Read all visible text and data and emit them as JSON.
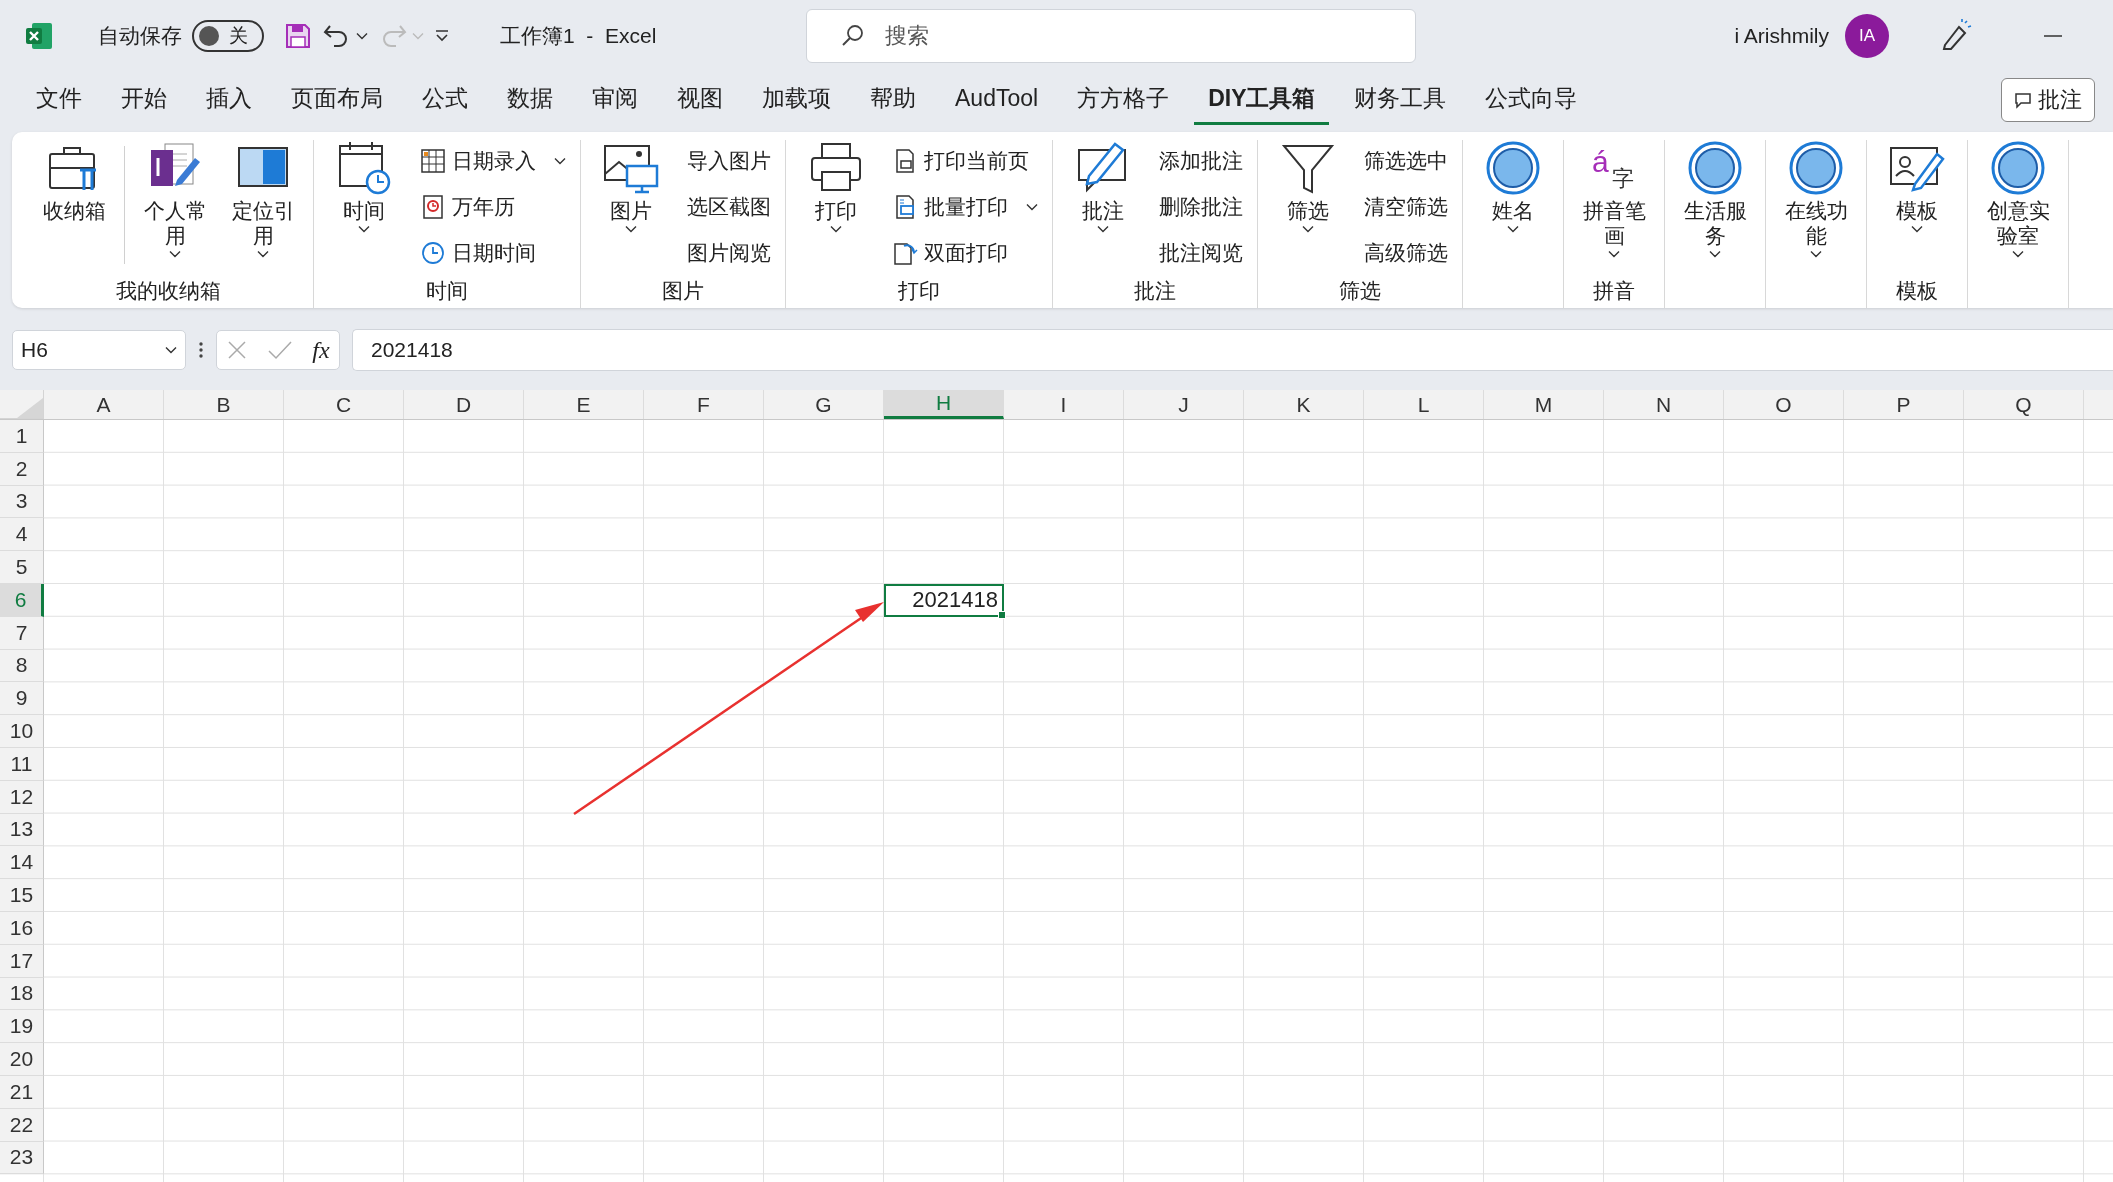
{
  "title_bar": {
    "autosave_label": "自动保存",
    "autosave": {
      "label": "关",
      "on": false
    },
    "redo": {
      "disabled": true
    },
    "title": "工作簿1  -  Excel",
    "search": {
      "placeholder": "搜索"
    },
    "user_name": "i Arishmily",
    "avatar_initials": "IA"
  },
  "tabs": [
    {
      "label": "文件",
      "selected": false
    },
    {
      "label": "开始",
      "selected": false
    },
    {
      "label": "插入",
      "selected": false
    },
    {
      "label": "页面布局",
      "selected": false
    },
    {
      "label": "公式",
      "selected": false
    },
    {
      "label": "数据",
      "selected": false
    },
    {
      "label": "审阅",
      "selected": false
    },
    {
      "label": "视图",
      "selected": false
    },
    {
      "label": "加载项",
      "selected": false
    },
    {
      "label": "帮助",
      "selected": false
    },
    {
      "label": "AudTool",
      "selected": false
    },
    {
      "label": "方方格子",
      "selected": false
    },
    {
      "label": "DIY工具箱",
      "selected": true
    },
    {
      "label": "财务工具",
      "selected": false
    },
    {
      "label": "公式向导",
      "selected": false
    }
  ],
  "comments_button": "批注",
  "ribbon": [
    {
      "label": "我的收纳箱",
      "items": [
        {
          "kind": "large",
          "label": "收纳箱",
          "dropdown": false
        },
        {
          "kind": "large",
          "label": "个人常用",
          "dropdown": true
        },
        {
          "kind": "large",
          "label": "定位引用",
          "dropdown": true
        }
      ]
    },
    {
      "label": "时间",
      "items": [
        {
          "kind": "large",
          "label": "时间",
          "dropdown": true
        },
        {
          "kind": "small",
          "label": "日期录入",
          "dropdown": true
        },
        {
          "kind": "small",
          "label": "万年历",
          "dropdown": false
        },
        {
          "kind": "small",
          "label": "日期时间",
          "dropdown": false
        }
      ]
    },
    {
      "label": "图片",
      "items": [
        {
          "kind": "large",
          "label": "图片",
          "dropdown": true
        },
        {
          "kind": "small",
          "label": "导入图片",
          "dropdown": false
        },
        {
          "kind": "small",
          "label": "选区截图",
          "dropdown": false
        },
        {
          "kind": "small",
          "label": "图片阅览",
          "dropdown": false
        }
      ]
    },
    {
      "label": "打印",
      "items": [
        {
          "kind": "large",
          "label": "打印",
          "dropdown": true
        },
        {
          "kind": "small",
          "label": "打印当前页",
          "dropdown": false
        },
        {
          "kind": "small",
          "label": "批量打印",
          "dropdown": true
        },
        {
          "kind": "small",
          "label": "双面打印",
          "dropdown": false
        }
      ]
    },
    {
      "label": "批注",
      "items": [
        {
          "kind": "large",
          "label": "批注",
          "dropdown": true
        },
        {
          "kind": "small",
          "label": "添加批注",
          "dropdown": false
        },
        {
          "kind": "small",
          "label": "删除批注",
          "dropdown": false
        },
        {
          "kind": "small",
          "label": "批注阅览",
          "dropdown": false
        }
      ]
    },
    {
      "label": "筛选",
      "items": [
        {
          "kind": "large",
          "label": "筛选",
          "dropdown": true
        },
        {
          "kind": "small",
          "label": "筛选选中",
          "dropdown": false
        },
        {
          "kind": "small",
          "label": "清空筛选",
          "dropdown": false
        },
        {
          "kind": "small",
          "label": "高级筛选",
          "dropdown": false
        }
      ]
    },
    {
      "items": [
        {
          "kind": "large",
          "label": "姓名",
          "dropdown": true
        }
      ]
    },
    {
      "label": "拼音",
      "items": [
        {
          "kind": "large",
          "label": "拼音笔画",
          "dropdown": true,
          "icon_text": "á",
          "icon_subtext": "字"
        }
      ]
    },
    {
      "items": [
        {
          "kind": "large",
          "label": "生活服务",
          "dropdown": true
        }
      ]
    },
    {
      "items": [
        {
          "kind": "large",
          "label": "在线功能",
          "dropdown": true
        }
      ]
    },
    {
      "label": "模板",
      "items": [
        {
          "kind": "large",
          "label": "模板",
          "dropdown": true
        }
      ]
    },
    {
      "items": [
        {
          "kind": "large",
          "label": "创意实验室",
          "dropdown": true
        }
      ]
    }
  ],
  "formula_bar": {
    "name_box": "H6",
    "function_label": "fx",
    "value": "2021418"
  },
  "sheet": {
    "columns": [
      {
        "label": "A",
        "selected": false
      },
      {
        "label": "B",
        "selected": false
      },
      {
        "label": "C",
        "selected": false
      },
      {
        "label": "D",
        "selected": false
      },
      {
        "label": "E",
        "selected": false
      },
      {
        "label": "F",
        "selected": false
      },
      {
        "label": "G",
        "selected": false
      },
      {
        "label": "H",
        "selected": true
      },
      {
        "label": "I",
        "selected": false
      },
      {
        "label": "J",
        "selected": false
      },
      {
        "label": "K",
        "selected": false
      },
      {
        "label": "L",
        "selected": false
      },
      {
        "label": "M",
        "selected": false
      },
      {
        "label": "N",
        "selected": false
      },
      {
        "label": "O",
        "selected": false
      },
      {
        "label": "P",
        "selected": false
      },
      {
        "label": "Q",
        "selected": false
      }
    ],
    "rows": [
      {
        "label": "1",
        "selected": false
      },
      {
        "label": "2",
        "selected": false
      },
      {
        "label": "3",
        "selected": false
      },
      {
        "label": "4",
        "selected": false
      },
      {
        "label": "5",
        "selected": false
      },
      {
        "label": "6",
        "selected": true
      },
      {
        "label": "7",
        "selected": false
      },
      {
        "label": "8",
        "selected": false
      },
      {
        "label": "9",
        "selected": false
      },
      {
        "label": "10",
        "selected": false
      },
      {
        "label": "11",
        "selected": false
      },
      {
        "label": "12",
        "selected": false
      },
      {
        "label": "13",
        "selected": false
      },
      {
        "label": "14",
        "selected": false
      },
      {
        "label": "15",
        "selected": false
      },
      {
        "label": "16",
        "selected": false
      },
      {
        "label": "17",
        "selected": false
      },
      {
        "label": "18",
        "selected": false
      },
      {
        "label": "19",
        "selected": false
      },
      {
        "label": "20",
        "selected": false
      },
      {
        "label": "21",
        "selected": false
      },
      {
        "label": "22",
        "selected": false
      },
      {
        "label": "23",
        "selected": false
      }
    ],
    "active_cell_value": "2021418"
  }
}
